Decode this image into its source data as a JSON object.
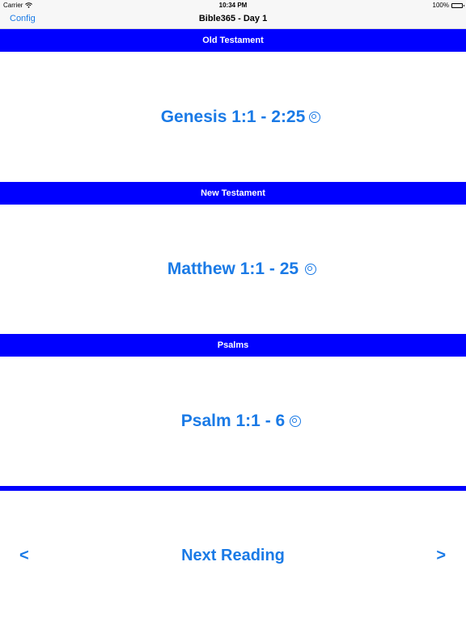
{
  "status_bar": {
    "carrier": "Carrier",
    "time": "10:34 PM",
    "battery": "100%"
  },
  "nav": {
    "config_label": "Config",
    "title": "Bible365 - Day 1"
  },
  "sections": [
    {
      "header": "Old Testament",
      "reference": "Genesis 1:1 - 2:25",
      "status_icon": "unread-circle-icon"
    },
    {
      "header": "New Testament",
      "reference": "Matthew 1:1 - 25",
      "status_icon": "unread-circle-icon"
    },
    {
      "header": "Psalms",
      "reference": "Psalm 1:1 - 6",
      "status_icon": "unread-circle-icon"
    }
  ],
  "footer": {
    "prev_label": "<",
    "next_reading_label": "Next Reading",
    "next_label": ">"
  },
  "colors": {
    "accent": "#1a7ae6",
    "header_bg": "#0000ff",
    "header_text": "#ffffff"
  }
}
